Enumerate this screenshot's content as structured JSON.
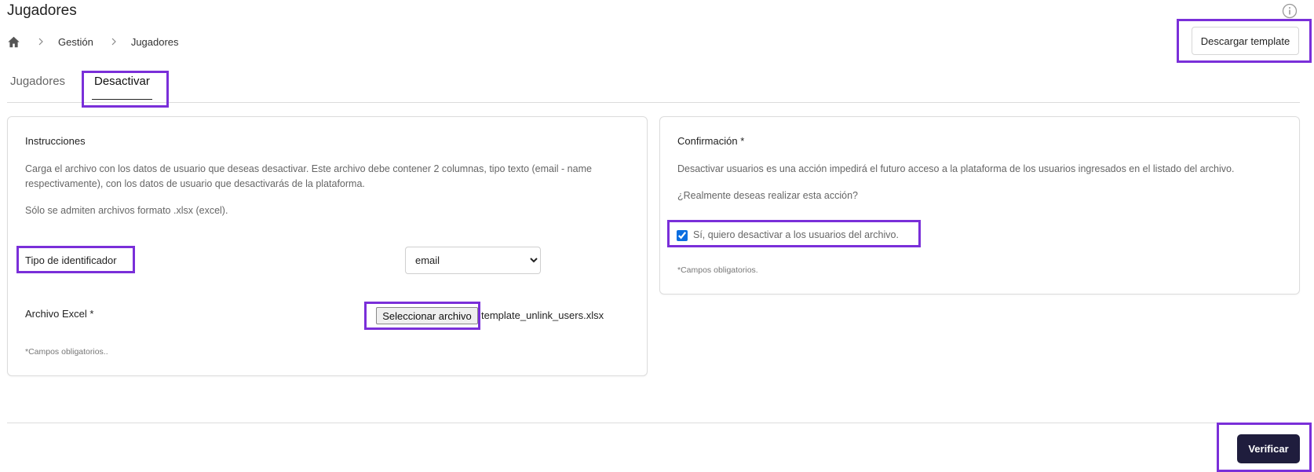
{
  "page": {
    "title": "Jugadores"
  },
  "breadcrumb": {
    "items": [
      "Gestión",
      "Jugadores"
    ]
  },
  "header": {
    "download_template_label": "Descargar template"
  },
  "tabs": [
    {
      "label": "Jugadores",
      "active": false
    },
    {
      "label": "Desactivar",
      "active": true
    }
  ],
  "instructions": {
    "title": "Instrucciones",
    "paragraph1": "Carga el archivo con los datos de usuario que deseas desactivar. Este archivo debe contener 2 columnas, tipo texto (email - name respectivamente), con los datos de usuario que desactivarás de la plataforma.",
    "paragraph2": "Sólo se admiten archivos formato .xlsx (excel).",
    "identifier_label": "Tipo de identificador",
    "identifier_selected": "email",
    "file_label": "Archivo Excel *",
    "file_button_label": "Seleccionar archivo",
    "file_name": "template_unlink_users.xlsx",
    "required_note": "*Campos obligatorios.."
  },
  "confirmation": {
    "title": "Confirmación *",
    "paragraph1": "Desactivar usuarios es una acción impedirá el futuro acceso a la plataforma de los usuarios ingresados en el listado del archivo.",
    "question": "¿Realmente deseas realizar esta acción?",
    "checkbox_label": "Sí, quiero desactivar a los usuarios del archivo.",
    "checkbox_checked": true,
    "required_note": "*Campos obligatorios."
  },
  "footer": {
    "verify_label": "Verificar"
  },
  "colors": {
    "highlight": "#7a2fd9",
    "primary_button": "#1f1d3d",
    "checkbox": "#0b6ee0"
  }
}
